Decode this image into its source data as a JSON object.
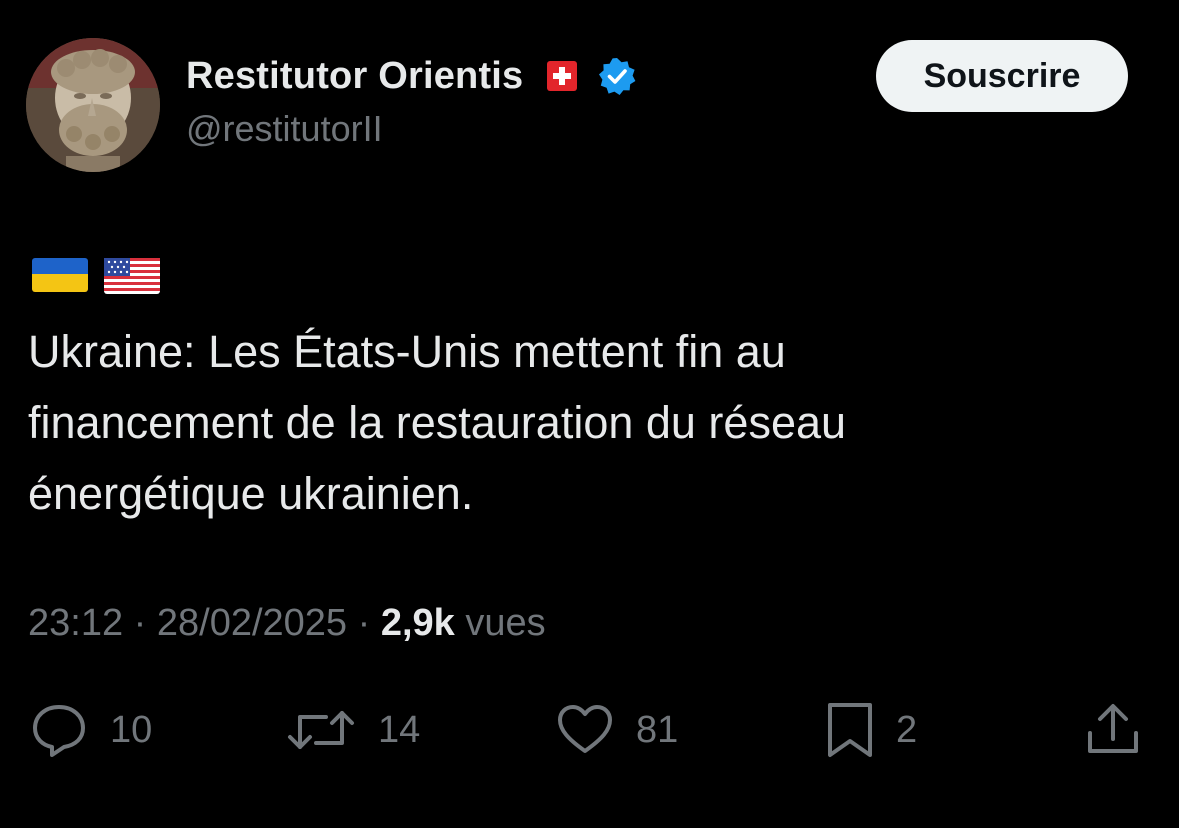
{
  "author": {
    "display_name": "Restitutor Orientis",
    "handle": "@restitutorII",
    "avatar_icon": "marble-bust-avatar",
    "name_flag_icon": "swiss-flag-icon",
    "verified_icon": "verified-badge-icon"
  },
  "subscribe_label": "Souscrire",
  "body": {
    "flag_icons": [
      "ukraine-flag-icon",
      "usa-flag-icon"
    ],
    "text": "Ukraine: Les États-Unis mettent fin au\nfinancement de la restauration du réseau\nénergétique ukrainien."
  },
  "meta": {
    "time": "23:12",
    "separator": "·",
    "date": "28/02/2025",
    "views_count": "2,9k",
    "views_label": "vues"
  },
  "actions": {
    "reply": {
      "icon": "reply-icon",
      "count": "10"
    },
    "repost": {
      "icon": "repost-icon",
      "count": "14"
    },
    "like": {
      "icon": "heart-icon",
      "count": "81"
    },
    "bookmark": {
      "icon": "bookmark-icon",
      "count": "2"
    },
    "share": {
      "icon": "share-icon"
    }
  },
  "colors": {
    "background": "#000000",
    "primary_text": "#e7e9ea",
    "secondary_text": "#71767b",
    "verified_blue": "#1d9bf0",
    "button_bg": "#eff3f4"
  }
}
